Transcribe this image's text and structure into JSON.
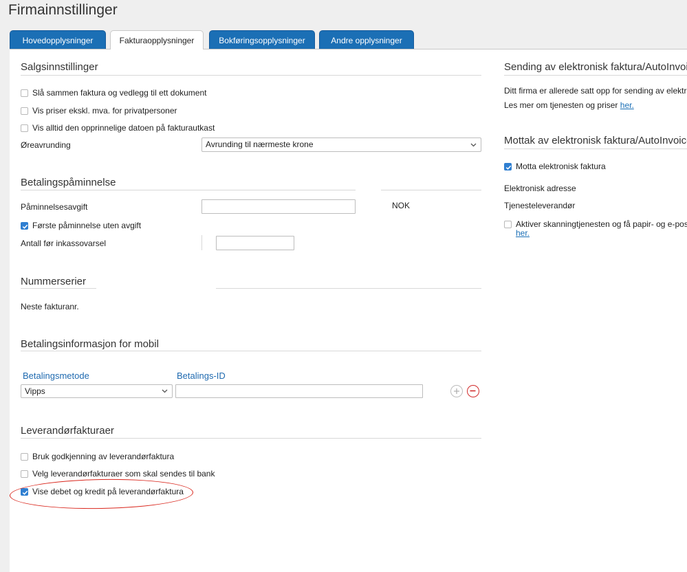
{
  "page": {
    "title": "Firmainnstillinger"
  },
  "tabs": [
    {
      "label": "Hovedopplysninger",
      "active": false
    },
    {
      "label": "Fakturaopplysninger",
      "active": true
    },
    {
      "label": "Bokføringsopplysninger",
      "active": false
    },
    {
      "label": "Andre opplysninger",
      "active": false
    }
  ],
  "sales": {
    "title": "Salgsinnstillinger",
    "options": [
      {
        "label": "Slå sammen faktura og vedlegg til ett dokument",
        "checked": false
      },
      {
        "label": "Vis priser ekskl. mva. for privatpersoner",
        "checked": false
      },
      {
        "label": "Vis alltid den opprinnelige datoen på fakturautkast",
        "checked": false
      }
    ],
    "rounding_label": "Øreavrunding",
    "rounding_value": "Avrunding til nærmeste krone"
  },
  "reminder": {
    "title": "Betalingspåminnelse",
    "fee_label": "Påminnelsesavgift",
    "fee_value": "",
    "currency": "NOK",
    "first_free_label": "Første påminnelse uten avgift",
    "first_free_checked": true,
    "count_label": "Antall før inkassovarsel",
    "count_value": ""
  },
  "numbering": {
    "title": "Nummerserier",
    "next_invoice_label": "Neste fakturanr."
  },
  "mobile_payment": {
    "title": "Betalingsinformasjon for mobil",
    "col_method": "Betalingsmetode",
    "col_id": "Betalings-ID",
    "method_value": "Vipps",
    "id_value": ""
  },
  "supplier": {
    "title": "Leverandørfakturaer",
    "options": [
      {
        "label": "Bruk godkjenning av leverandørfaktura",
        "checked": false
      },
      {
        "label": "Velg leverandørfakturaer som skal sendes til bank",
        "checked": false
      },
      {
        "label": "Vise debet og kredit på leverandørfaktura",
        "checked": true
      }
    ]
  },
  "einvoice_send": {
    "title": "Sending av elektronisk faktura/AutoInvoice",
    "text": "Ditt firma er allerede satt opp for sending av elektro",
    "more_text": "Les mer om tjenesten og priser",
    "link": "her."
  },
  "einvoice_receive": {
    "title": "Mottak av elektronisk faktura/AutoInvoice",
    "receive_label": "Motta elektronisk faktura",
    "receive_checked": true,
    "address_label": "Elektronisk adresse",
    "provider_label": "Tjenesteleverandør",
    "scan_label": "Aktiver skanningtjenesten og få papir- og e-post f",
    "scan_checked": false,
    "scan_link": "her."
  },
  "colors": {
    "tab_blue": "#1b6fb5",
    "checkbox_blue": "#2f7fd1",
    "link_blue": "#1a6fb6",
    "highlight_red": "#d9261c"
  }
}
